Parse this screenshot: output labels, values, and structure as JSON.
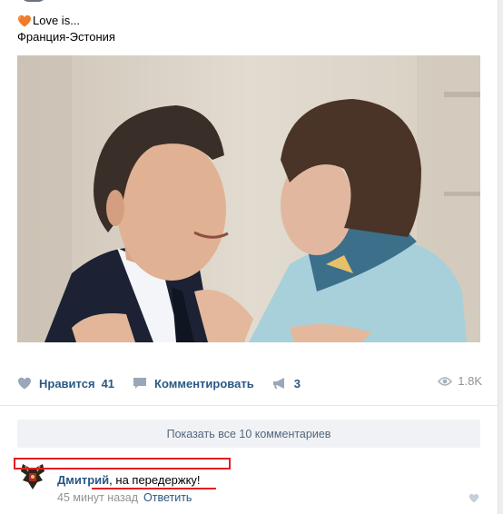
{
  "post": {
    "text_line1": "Love is...",
    "text_line2": "Франция-Эстония"
  },
  "actions": {
    "like_label": "Нравится",
    "like_count": "41",
    "comment_label": "Комментировать",
    "share_count": "3",
    "views_count": "1.8K"
  },
  "comments": {
    "show_all_label": "Показать все 10 комментариев",
    "item": {
      "author": "Дмитрий",
      "text": ", на передержку!",
      "time": "45 минут назад",
      "reply_label": "Ответить"
    }
  },
  "colors": {
    "link": "#2a5885",
    "muted": "#939393",
    "highlight": "#e31e24"
  }
}
